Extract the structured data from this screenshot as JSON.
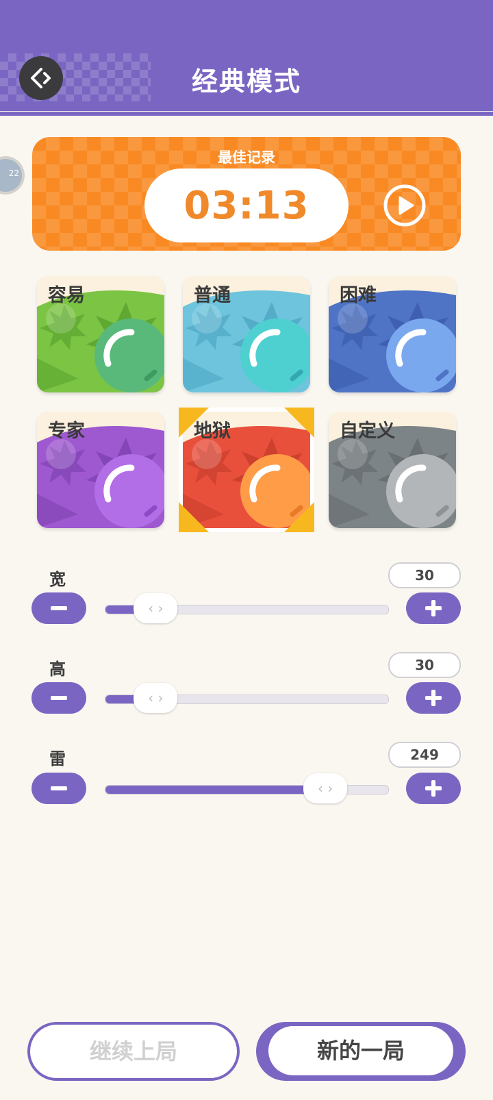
{
  "header": {
    "title": "经典模式",
    "back_icon": "back-arrow-icon"
  },
  "side_badge": {
    "text": "22"
  },
  "best": {
    "label": "最佳记录",
    "time": "03:13"
  },
  "difficulties": [
    {
      "label": "容易",
      "main": "#7cc444",
      "dark": "#5aa52f",
      "ball": "#58b97a",
      "ball_dark": "#3d9a61"
    },
    {
      "label": "普通",
      "main": "#6dc4dc",
      "dark": "#4fa8c4",
      "ball": "#4fd0d0",
      "ball_dark": "#33a8b2"
    },
    {
      "label": "困难",
      "main": "#4f74c6",
      "dark": "#3c5cab",
      "ball": "#7aa8ee",
      "ball_dark": "#4f74c6"
    },
    {
      "label": "专家",
      "main": "#9e58d0",
      "dark": "#7f43b1",
      "ball": "#b26ee6",
      "ball_dark": "#8d4ac7"
    },
    {
      "label": "地狱",
      "main": "#e8503c",
      "dark": "#c93d2c",
      "ball": "#ff9c48",
      "ball_dark": "#e97a26",
      "selected": true
    },
    {
      "label": "自定义",
      "main": "#7d8487",
      "dark": "#656b6e",
      "ball": "#b2b6b9",
      "ball_dark": "#8c9194"
    }
  ],
  "sliders": [
    {
      "label": "宽",
      "value": "30",
      "fraction": 0.18
    },
    {
      "label": "高",
      "value": "30",
      "fraction": 0.18
    },
    {
      "label": "雷",
      "value": "249",
      "fraction": 0.78
    }
  ],
  "buttons": {
    "continue": "继续上局",
    "new_game": "新的一局"
  },
  "colors": {
    "accent": "#7a66c2",
    "best_bg": "#f98a23",
    "selected_corner": "#f7b81f"
  }
}
